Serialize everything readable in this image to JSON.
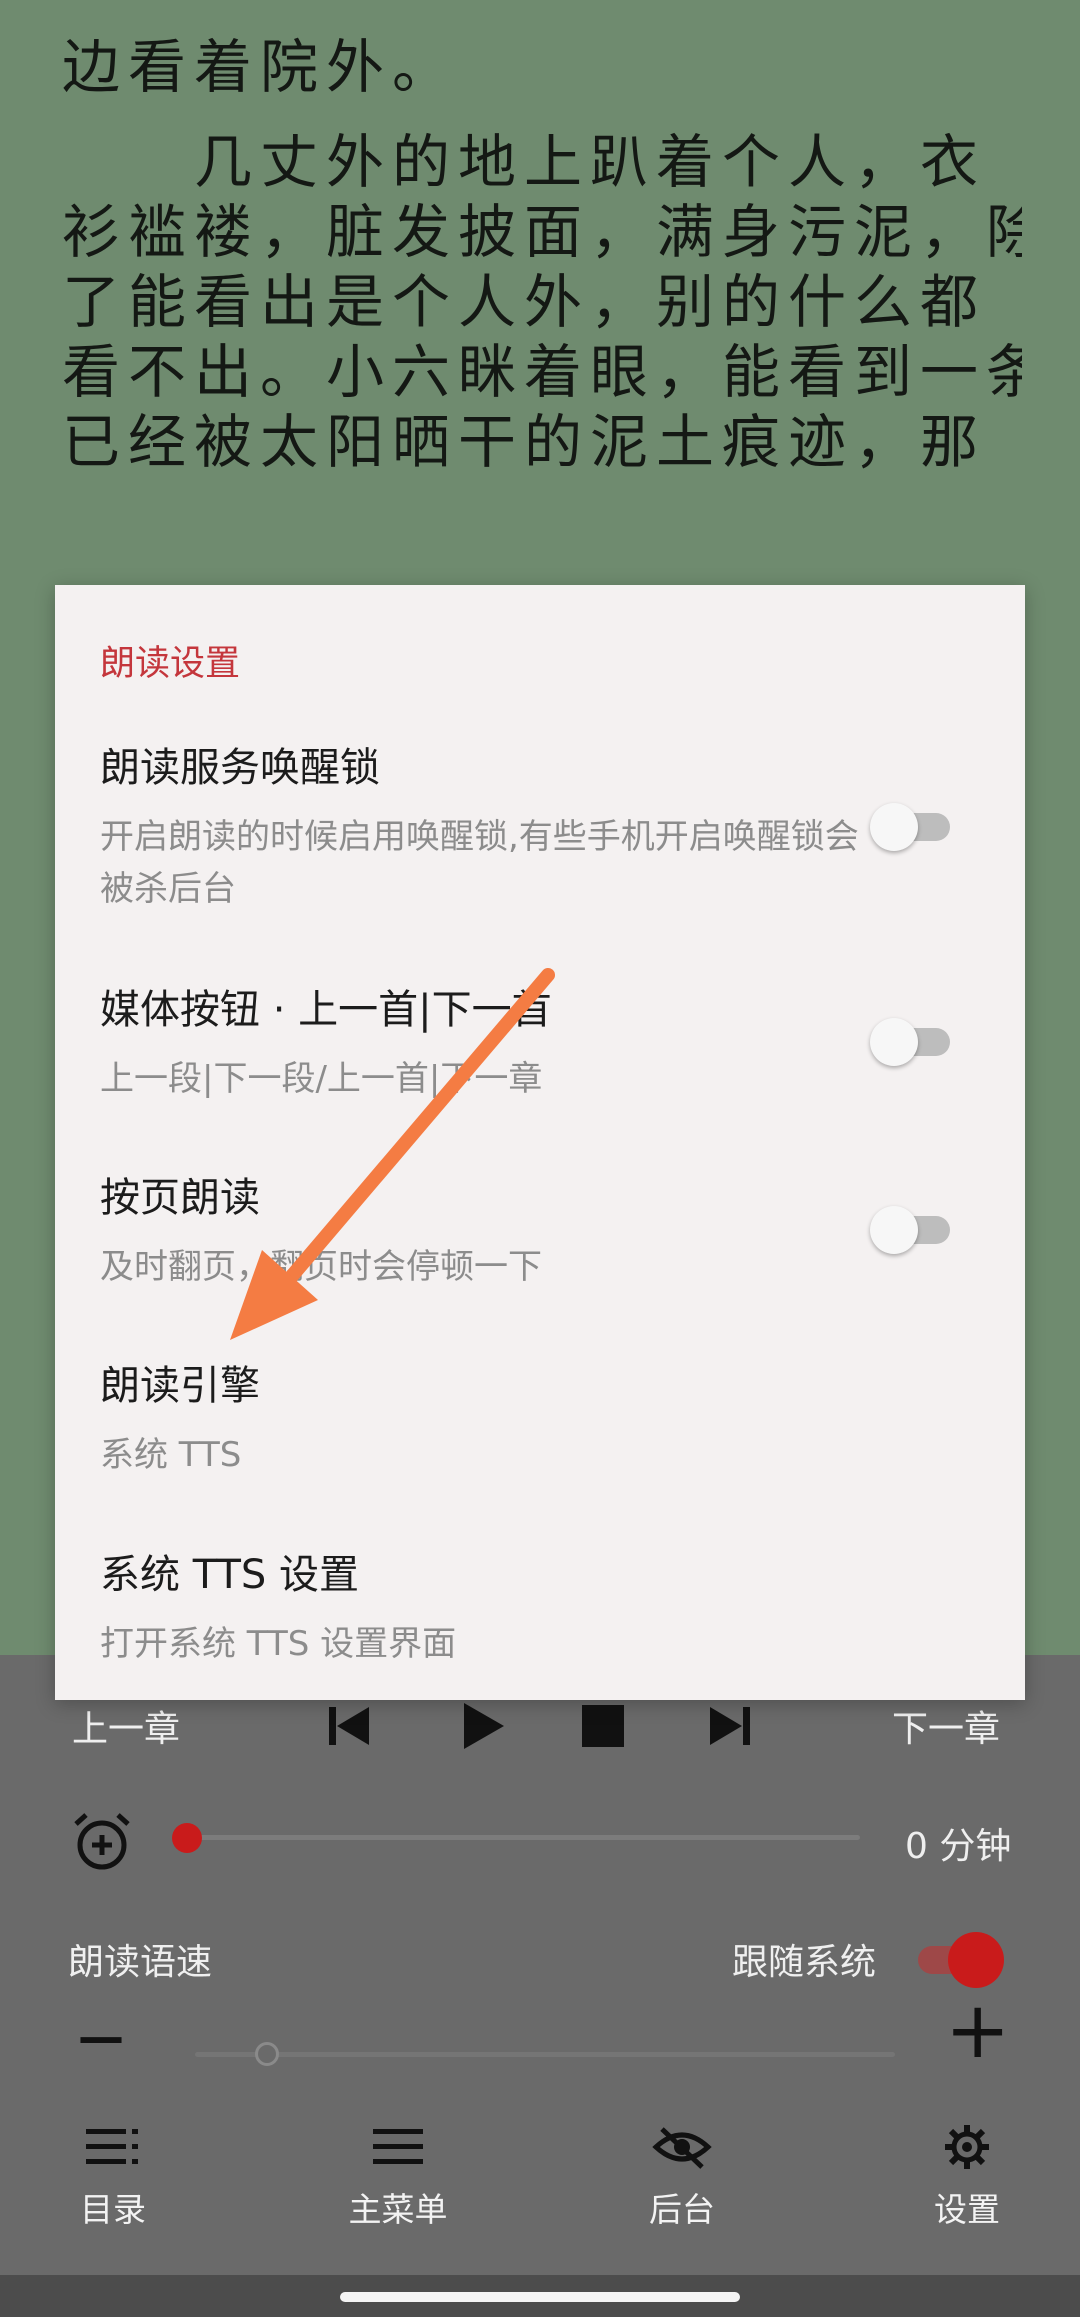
{
  "reader": {
    "lines": [
      "边看着院外。",
      "　　几丈外的地上趴着个人，衣",
      "衫褴褛，脏发披面，满身污泥，除",
      "了能看出是个人外，别的什么都",
      "看不出。小六眯着眼，能看到一条",
      "已经被太阳晒干的泥土痕迹，那"
    ]
  },
  "dialog": {
    "title": "朗读设置",
    "options": [
      {
        "title": "朗读服务唤醒锁",
        "subtitle": "开启朗读的时候启用唤醒锁,有些手机开启唤醒锁会被杀后台",
        "switch_on": false
      },
      {
        "title": "媒体按钮 · 上一首|下一首",
        "subtitle": "上一段|下一段/上一首|下一章",
        "switch_on": false
      },
      {
        "title": "按页朗读",
        "subtitle": "及时翻页，翻页时会停顿一下",
        "switch_on": false
      },
      {
        "title": "朗读引擎",
        "subtitle": "系统 TTS"
      },
      {
        "title": "系统 TTS 设置",
        "subtitle": "打开系统 TTS 设置界面"
      }
    ]
  },
  "controls": {
    "prev_chapter": "上一章",
    "next_chapter": "下一章",
    "timer_value": "0 分钟",
    "speed_label": "朗读语速",
    "follow_system_label": "跟随系统",
    "follow_system_on": true,
    "minus": "—",
    "plus": "+"
  },
  "bottom_nav": [
    {
      "label": "目录",
      "icon": "list-icon"
    },
    {
      "label": "主菜单",
      "icon": "menu-icon"
    },
    {
      "label": "后台",
      "icon": "eye-off-icon"
    },
    {
      "label": "设置",
      "icon": "gear-icon"
    }
  ],
  "colors": {
    "accent": "#c4363c",
    "reader_bg": "#6f8b6f",
    "annotation_arrow": "#f47c43"
  }
}
